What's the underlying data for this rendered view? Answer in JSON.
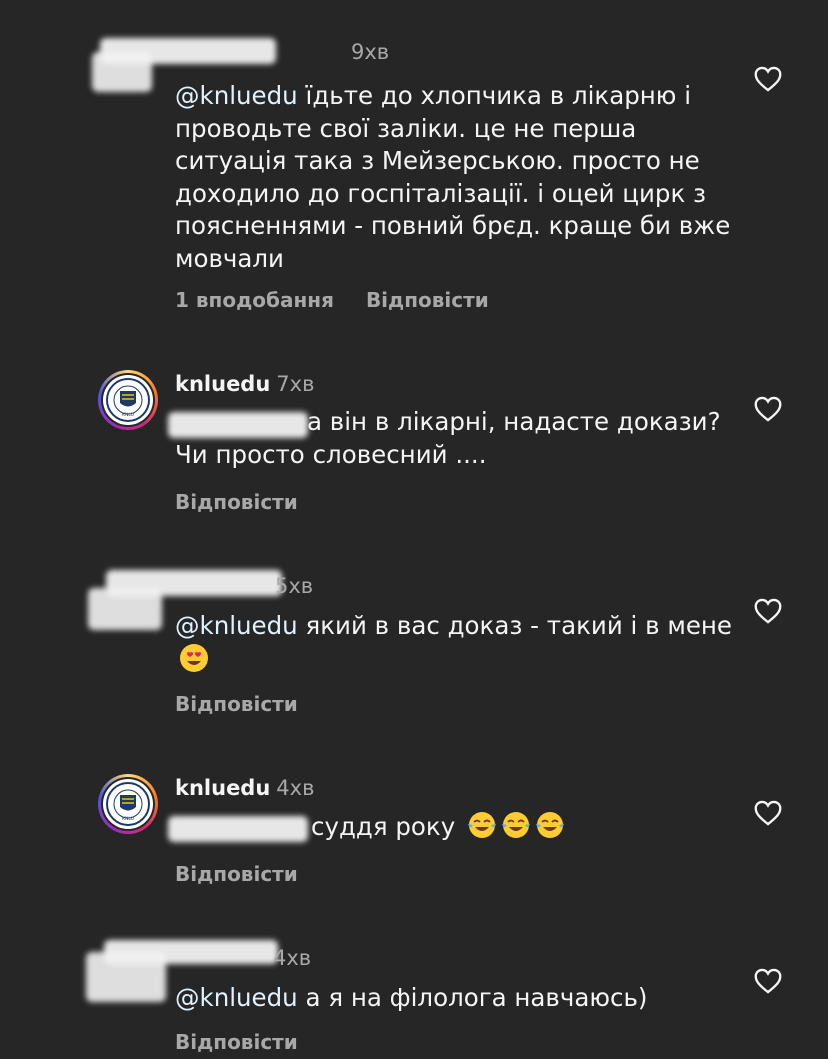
{
  "comments": [
    {
      "username": "",
      "time": "9хв",
      "mention": "@knluedu",
      "text": "їдьте до хлопчика в лікарню і проводьте свої заліки. це не перша ситуація така з Мейзерською. просто не доходило до госпіталізації. і оцей цирк з поясненнями - повний брєд. краще би вже мовчали",
      "likes": "1 вподобання",
      "reply": "Відповісти",
      "icons": [
        "heart-icon"
      ]
    },
    {
      "username": "knluedu",
      "time": "7хв",
      "mention": "",
      "text": "а він в лікарні, надасте докази? Чи просто словесний ....",
      "reply": "Відповісти",
      "icons": [
        "heart-icon",
        "university-logo"
      ]
    },
    {
      "username": "",
      "time": "5хв",
      "mention": "@knluedu",
      "text": "який в вас доказ - такий і в мене",
      "emoji": "heart-eyes-emoji",
      "reply": "Відповісти",
      "icons": [
        "heart-icon"
      ]
    },
    {
      "username": "knluedu",
      "time": "4хв",
      "mention": "",
      "text": "суддя року",
      "emoji": "tears-of-joy-emoji x3",
      "reply": "Відповісти",
      "icons": [
        "heart-icon",
        "university-logo"
      ]
    },
    {
      "username": "",
      "time": "4хв",
      "mention": "@knluedu",
      "text": "а я на філолога навчаюсь)",
      "reply": "Відповісти",
      "icons": [
        "heart-icon"
      ]
    }
  ],
  "colors": {
    "background": "#262626",
    "text": "#f5f5f5",
    "secondary": "#a8a8a8",
    "mention": "#e0f1ff"
  }
}
